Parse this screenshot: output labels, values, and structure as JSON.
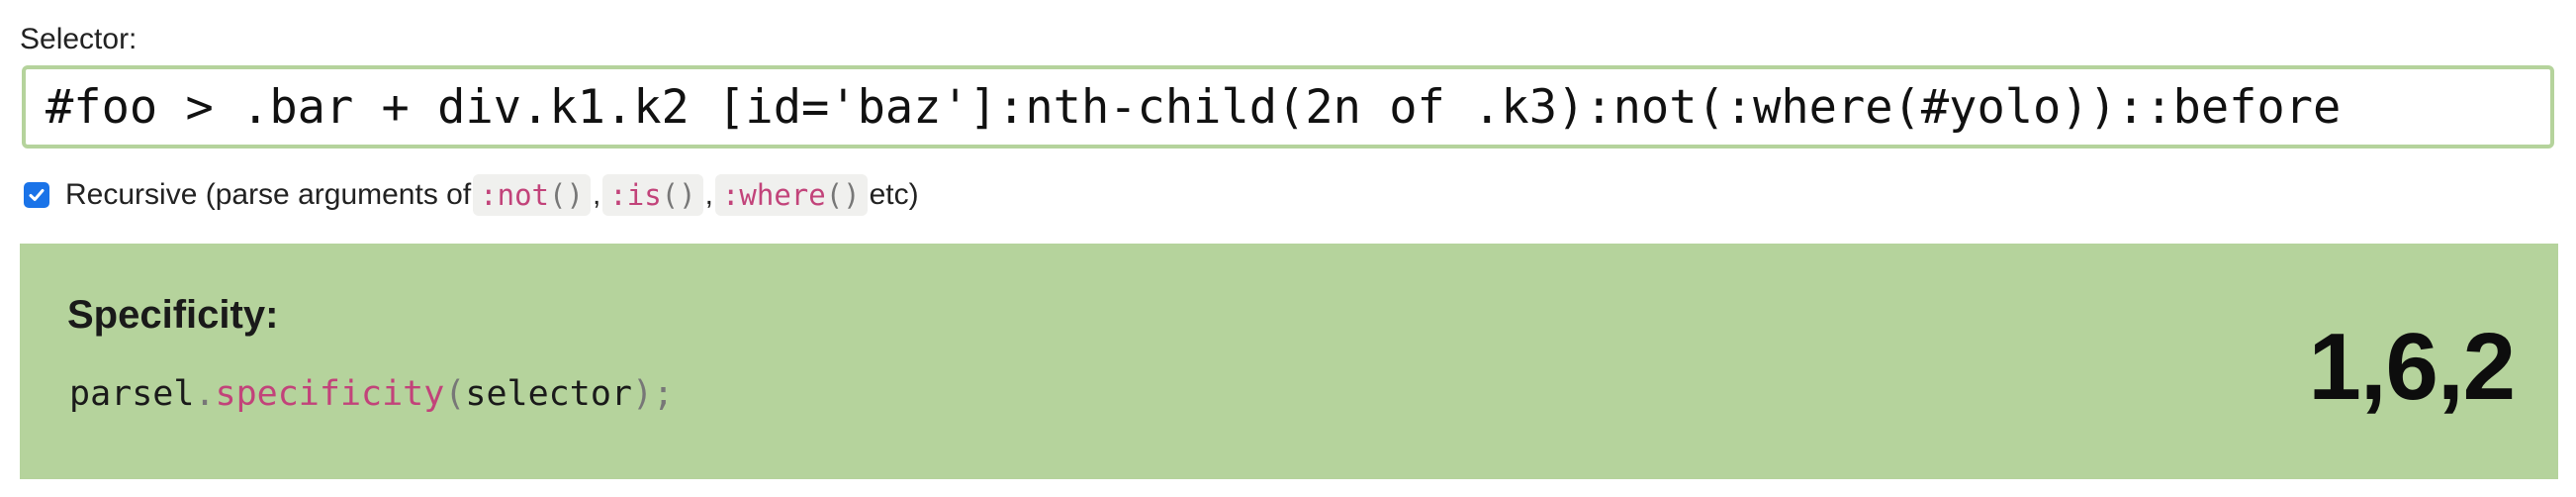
{
  "selector": {
    "label": "Selector:",
    "value": "#foo > .bar + div.k1.k2 [id='baz']:nth-child(2n of .k3):not(:where(#yolo))::before"
  },
  "recursive": {
    "checked": true,
    "label_prefix": "Recursive (parse arguments of ",
    "chips": [
      {
        "name": ":not",
        "parens": "()"
      },
      {
        "name": ":is",
        "parens": "()"
      },
      {
        "name": ":where",
        "parens": "()"
      }
    ],
    "separator": ", ",
    "label_suffix": " etc)"
  },
  "result": {
    "heading": "Specificity:",
    "code": {
      "object": "parsel",
      "dot": ".",
      "method": "specificity",
      "open_paren": "(",
      "argument": "selector",
      "close": ");"
    },
    "value": "1,6,2"
  },
  "colors": {
    "accent_green": "#b5d39c",
    "checkbox_blue": "#1a73e8",
    "code_pink": "#c2437a"
  }
}
